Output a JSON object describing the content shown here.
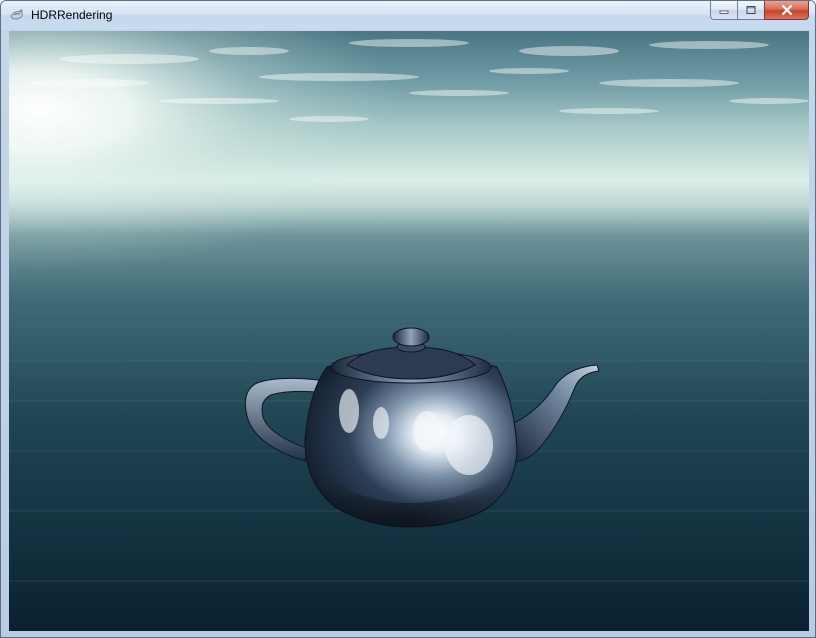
{
  "window": {
    "title": "HDRRendering",
    "app_icon": "app-icon",
    "controls": {
      "minimize_icon": "minimize-icon",
      "maximize_icon": "maximize-icon",
      "close_icon": "close-icon"
    }
  },
  "scene": {
    "subject": "teapot",
    "sky_top": "#3e6a78",
    "horizon_glow": "#eef8f4",
    "sea_far": "#2b5766",
    "sea_near": "#0a2230",
    "teapot_base": "#1c2c40",
    "teapot_highlight": "#f2f6fa"
  }
}
